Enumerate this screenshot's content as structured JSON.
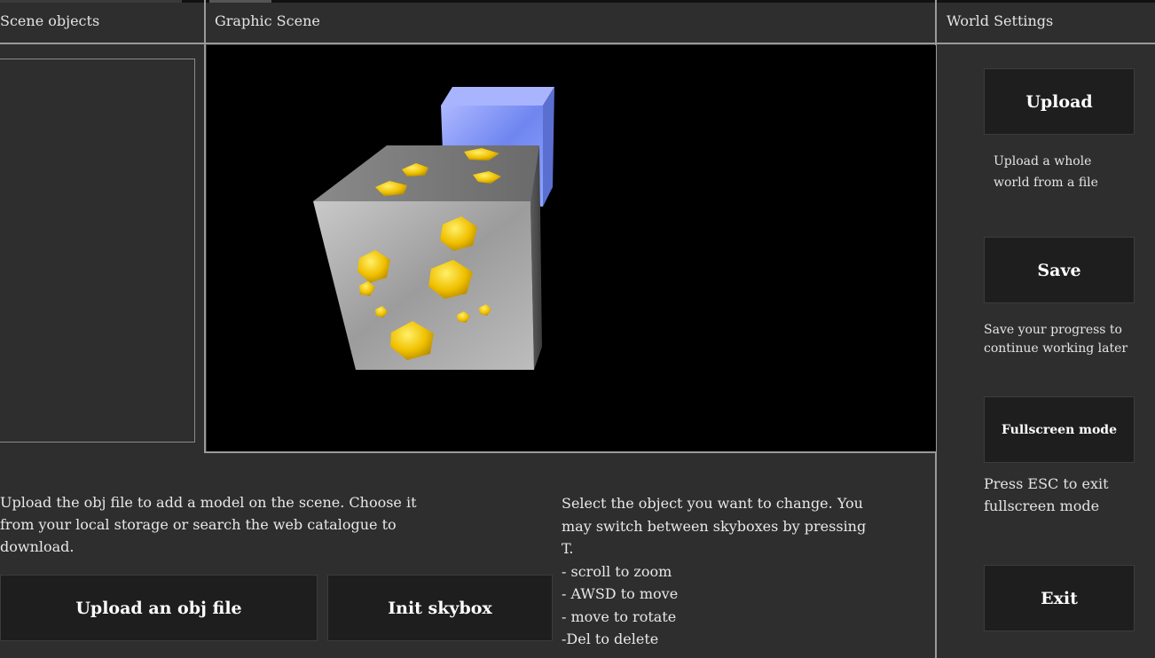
{
  "panels": {
    "objects_title": "Scene objects",
    "scene_title": "Graphic Scene",
    "settings_title": "World Settings"
  },
  "instructions": {
    "upload_help": "Upload the obj file to add a model on the scene. Choose it from your local storage or search the web catalogue to download.",
    "controls_help": "Select the object you want to change. You may switch between skyboxes by pressing T.\n- scroll to zoom\n- AWSD to move\n- move to rotate\n-Del to delete"
  },
  "bottom_buttons": {
    "upload_obj": "Upload an obj file",
    "init_skybox": "Init skybox"
  },
  "settings": {
    "upload_label": "Upload",
    "upload_desc": "Upload a whole world from a file",
    "save_label": "Save",
    "save_desc": "Save your progress to continue working later",
    "fullscreen_label": "Fullscreen mode",
    "fullscreen_desc": "Press ESC to exit fullscreen mode",
    "exit_label": "Exit"
  },
  "colors": {
    "background": "#2e2e2e",
    "button": "#1e1e1e",
    "divider": "#9a9a9a",
    "canvas": "#000000",
    "gold_ore": "#f2c400",
    "stone": "#a8a8a8",
    "blue_cube": "#8fa8ff"
  }
}
